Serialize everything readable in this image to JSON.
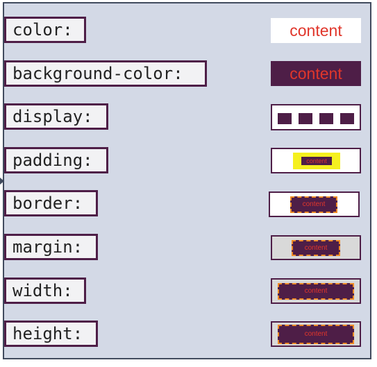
{
  "properties": [
    {
      "label": "color:"
    },
    {
      "label": "background-color:"
    },
    {
      "label": "display:"
    },
    {
      "label": "padding:"
    },
    {
      "label": "border:"
    },
    {
      "label": "margin:"
    },
    {
      "label": "width:"
    },
    {
      "label": "height:"
    }
  ],
  "demo_text": "content",
  "colors": {
    "panel_bg": "#d3d9e6",
    "label_border": "#4e1e47",
    "content_text": "#e0362b",
    "highlight": "#f5f01f",
    "dashed_border": "#f08a24"
  }
}
